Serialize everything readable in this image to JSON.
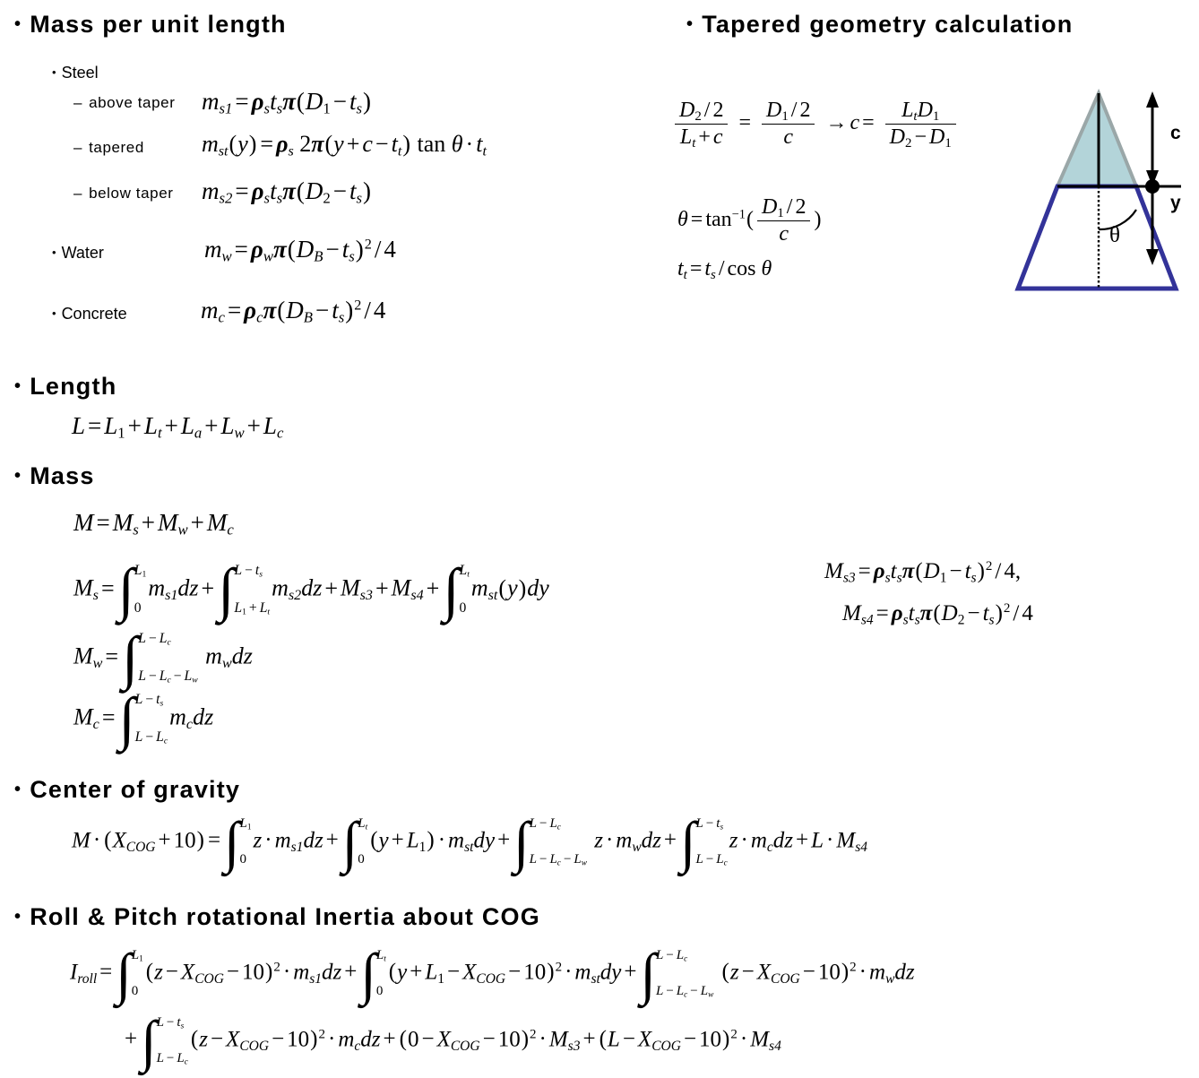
{
  "slide": {
    "sections": {
      "mass_per_unit_length": "Mass per unit length",
      "tapered_geometry": "Tapered geometry calculation",
      "length": "Length",
      "mass": "Mass",
      "center_of_gravity": "Center of gravity",
      "roll_pitch": "Roll & Pitch rotational Inertia about COG"
    },
    "labels": {
      "steel": "Steel",
      "above_taper": "above taper",
      "tapered": "tapered",
      "below_taper": "below taper",
      "water": "Water",
      "concrete": "Concrete",
      "bullet": "•",
      "subbullet": "•",
      "dash": "–"
    },
    "diagram": {
      "label_c": "c",
      "label_y": "y",
      "label_theta": "θ",
      "cone_fill": "#b3d4d9",
      "cone_edge": "#9aa7a8",
      "trapezoid_edge": "#333399",
      "axis_color": "#000000"
    },
    "formulas": {
      "m_s1": "m_s1 = rho_s t_s pi ( D_1 - t_s )",
      "m_st": "m_st(y) = rho_s 2 pi ( y + c - t_t ) tan theta . t_t",
      "m_s2": "m_s2 = rho_s t_s pi ( D_2 - t_s )",
      "m_w": "m_w = rho_w pi ( D_B - t_s )^2 / 4",
      "m_c": "m_c = rho_c pi ( D_B - t_s )^2 / 4",
      "taper_ratio": "(D_2/2)/(L_t + c) = (D_1/2)/c -> c = L_t D_1 / (D_2 - D_1)",
      "theta": "theta = tan^-1 ( (D_1/2) / c )",
      "t_t": "t_t = t_s / cos theta",
      "length": "L = L_1 + L_t + L_a + L_w + L_c",
      "mass_total": "M = M_s + M_w + M_c",
      "mass_steel": "M_s = int_0^L_1 m_s1 dz + int_(L_1+L_t)^(L-t_s) m_s2 dz + M_s3 + M_s4 + int_0^L_t m_st(y) dy",
      "mass_water": "M_w = int_(L-L_c-L_w)^(L-L_c) m_w dz",
      "mass_concrete": "M_c = int_(L-L_c)^(L-t_s) m_c dz",
      "m_s3": "M_s3 = rho_s t_s pi ( D_1 - t_s )^2 / 4,",
      "m_s4": "M_s4 = rho_s t_s pi ( D_2 - t_s )^2 / 4",
      "cog": "M . ( X_COG + 10 ) = int_0^L_1 z . m_s1 dz + int_0^L_t ( y + L_1 ) . m_st dy + int_(L-L_c-L_w)^(L-L_c) z . m_w dz + int_(L-L_c)^(L-t_s) z . m_c dz + L . M_s4",
      "i_roll_line1": "I_roll = int_0^L_1 ( z - X_COG - 10 )^2 . m_s1 dz + int_0^L_t ( y + L_1 - X_COG - 10 )^2 . m_st dy + int_(L-L_c-L_w)^(L-L_c) ( z - X_COG - 10 )^2 . m_w dz",
      "i_roll_line2": "+ int_(L-L_c)^(L-t_s) ( z - X_COG - 10 )^2 . m_c dz + ( 0 - X_COG - 10 )^2 . M_s3 + ( L - X_COG - 10 )^2 . M_s4"
    },
    "symbols": {
      "rho": "ρ",
      "pi": "π",
      "theta": "θ",
      "integral": "∫",
      "arrow": "→",
      "cdot": "·",
      "minus": "−",
      "plus": "+",
      "equals": "="
    }
  }
}
